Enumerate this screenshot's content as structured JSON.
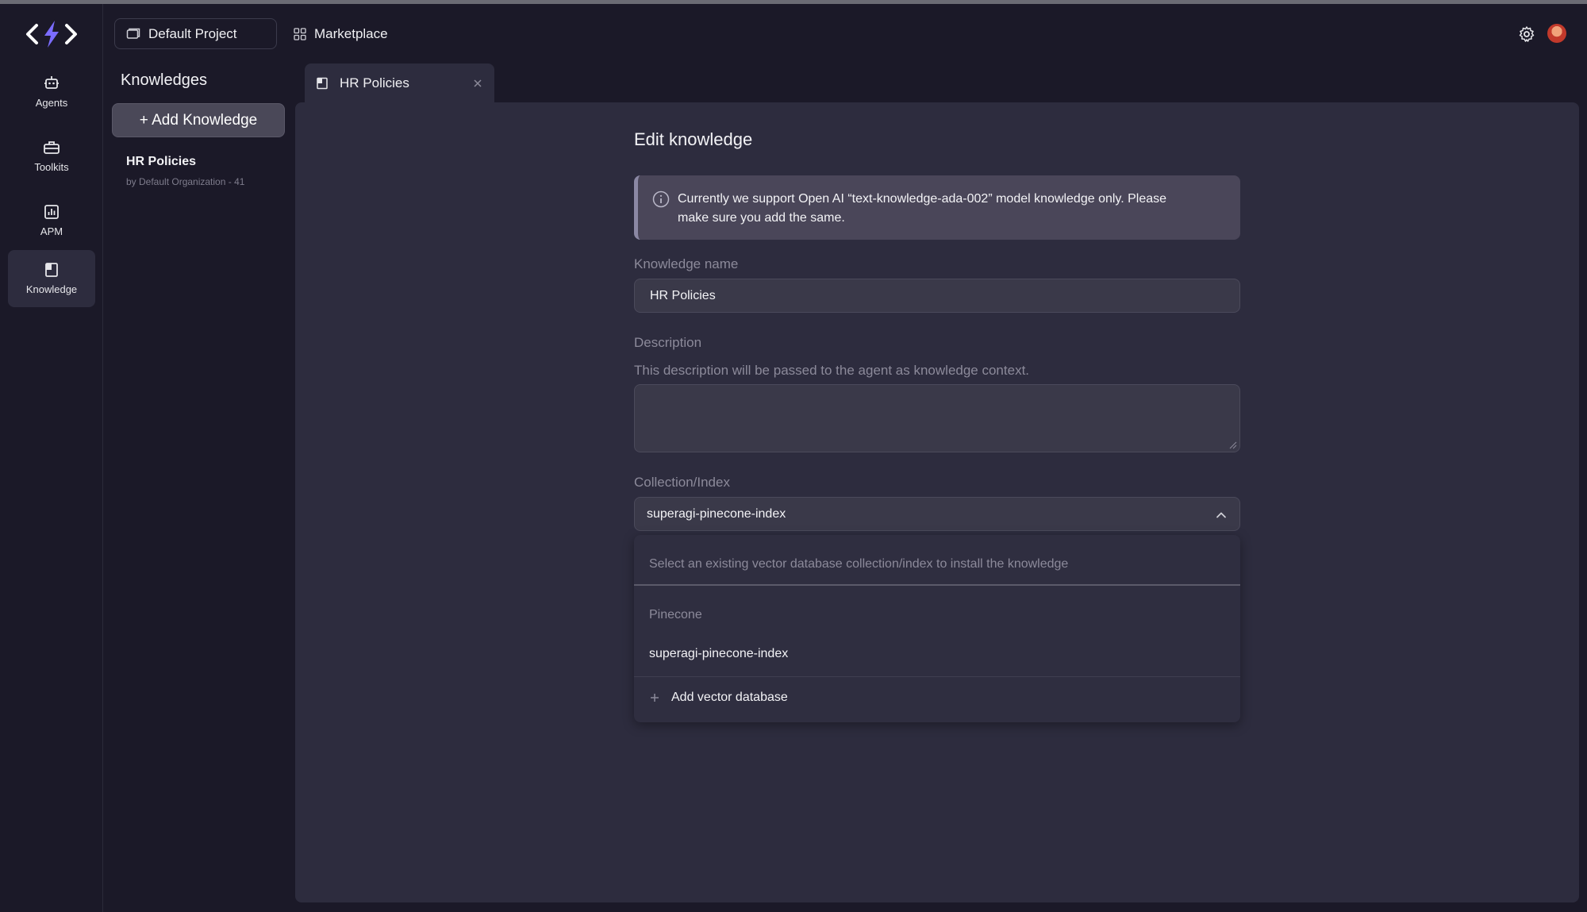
{
  "header": {
    "project_label": "Default Project",
    "marketplace_label": "Marketplace"
  },
  "rail": {
    "items": [
      {
        "label": "Agents",
        "icon": "robot-icon"
      },
      {
        "label": "Toolkits",
        "icon": "toolbox-icon"
      },
      {
        "label": "APM",
        "icon": "chart-icon"
      },
      {
        "label": "Knowledge",
        "icon": "book-icon",
        "active": true
      }
    ]
  },
  "knowledge_panel": {
    "title": "Knowledges",
    "add_button": "+ Add Knowledge",
    "items": [
      {
        "name": "HR Policies",
        "subtitle": "by Default Organization - 41"
      }
    ]
  },
  "tab": {
    "label": "HR Policies"
  },
  "form": {
    "title": "Edit knowledge",
    "info_line1": "Currently we support Open AI “text-knowledge-ada-002” model knowledge only. Please",
    "info_line2": "make sure you add the same.",
    "name_label": "Knowledge name",
    "name_value": "HR Policies",
    "description_label": "Description",
    "description_hint": "This description will be passed to the agent as knowledge context.",
    "description_value": "",
    "collection_label": "Collection/Index",
    "collection_value": "superagi-pinecone-index",
    "dropdown": {
      "hint": "Select an existing vector database collection/index to install the knowledge",
      "group": "Pinecone",
      "options": [
        "superagi-pinecone-index"
      ],
      "add_label": "Add vector database"
    }
  },
  "colors": {
    "background": "#1b1928",
    "panel": "#2d2c3e",
    "input": "#3a3949",
    "info_banner": "#4a4659",
    "accent_logo": "#7b6cff"
  }
}
